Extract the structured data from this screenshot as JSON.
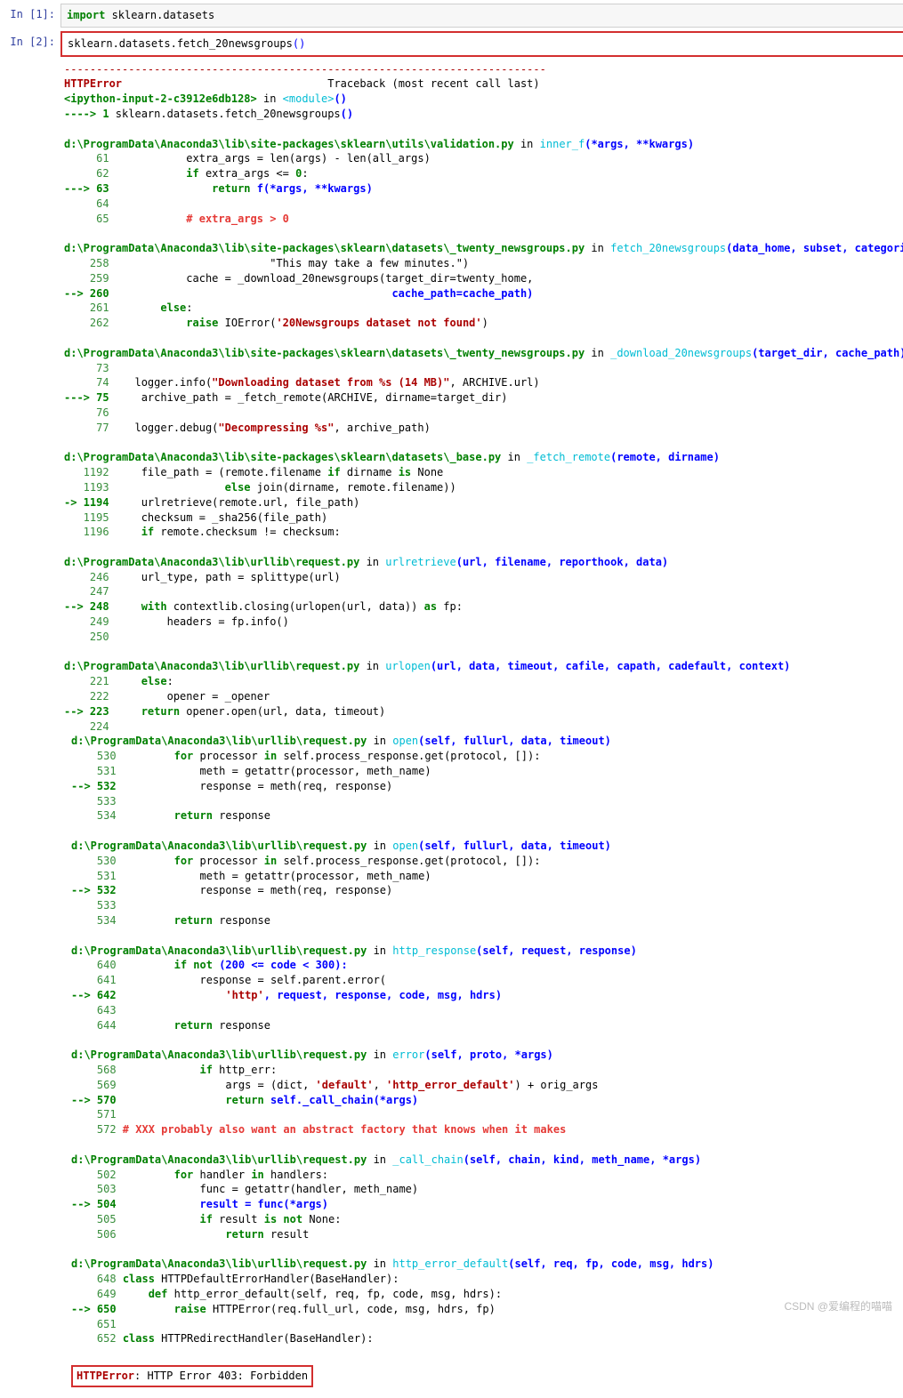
{
  "cells": {
    "in1": {
      "prompt": "In  [1]:",
      "kw": "import",
      "mod": " sklearn.datasets"
    },
    "in2": {
      "prompt": "In  [2]:",
      "code_pre": "sklearn.datasets.fetch_20newsgroups",
      "paren": "()"
    }
  },
  "err": {
    "dashes": "---------------------------------------------------------------------------",
    "name": "HTTPError",
    "trace_hdr": "                                Traceback (most recent call last)",
    "ipy1": "<ipython-input-2-c3912e6db128>",
    "ipy2": " in ",
    "ipy3": "<module>",
    "ipy4": "()",
    "arrow_line": "----> 1 ",
    "arrow_code": "sklearn.datasets.fetch_20newsgroups",
    "arrow_paren": "()",
    "final_name": "HTTPError",
    "final_msg": ": HTTP Error 403: Forbidden"
  },
  "f1": {
    "path": "d:\\ProgramData\\Anaconda3\\lib\\site-packages\\sklearn\\utils\\validation.py",
    "in": " in ",
    "fn": "inner_f",
    "sig": "(*args, **kwargs)",
    "l61n": "     61",
    "l61": "            extra_args = len(args) - len(all_args)",
    "l62n": "     62",
    "l62a": "            ",
    "l62if": "if",
    "l62b": " extra_args <= ",
    "l62z": "0",
    "l62c": ":",
    "l63a": "---> 63",
    "l63b": "                ",
    "l63r": "return",
    "l63c": " f(*args, **kwargs)",
    "l64n": "     64",
    "l65n": "     65",
    "l65": "            # extra_args > 0"
  },
  "f2": {
    "path": "d:\\ProgramData\\Anaconda3\\lib\\site-packages\\sklearn\\datasets\\_twenty_newsgroups.py",
    "in": " in ",
    "fn": "fetch_20newsgroups",
    "sig": "(data_home, subset, categories, shuffle, random_state, remove, download_if_missing, return_X_y)",
    "l258n": "    258",
    "l258": "                         \"This may take a few minutes.\")",
    "l259n": "    259",
    "l259": "            cache = _download_20newsgroups(target_dir=twenty_home,",
    "l260a": "--> 260",
    "l260": "                                            cache_path=cache_path)",
    "l261n": "    261",
    "l261a": "        ",
    "l261e": "else",
    "l261b": ":",
    "l262n": "    262",
    "l262a": "            ",
    "l262r": "raise",
    "l262b": " IOError(",
    "l262s": "'20Newsgroups dataset not found'",
    "l262c": ")"
  },
  "f3": {
    "path": "d:\\ProgramData\\Anaconda3\\lib\\site-packages\\sklearn\\datasets\\_twenty_newsgroups.py",
    "in": " in ",
    "fn": "_download_20newsgroups",
    "sig": "(target_dir, cache_path)",
    "l73n": "     73",
    "l74n": "     74",
    "l74a": "    logger.info(",
    "l74s": "\"Downloading dataset from %s (14 MB)\"",
    "l74b": ", ARCHIVE.url)",
    "l75a": "---> 75",
    "l75": "     archive_path = _fetch_remote(ARCHIVE, dirname=target_dir)",
    "l76n": "     76",
    "l77n": "     77",
    "l77a": "    logger.debug(",
    "l77s": "\"Decompressing %s\"",
    "l77b": ", archive_path)"
  },
  "f4": {
    "path": "d:\\ProgramData\\Anaconda3\\lib\\site-packages\\sklearn\\datasets\\_base.py",
    "in": " in ",
    "fn": "_fetch_remote",
    "sig": "(remote, dirname)",
    "l1192n": "   1192",
    "l1192a": "     file_path = (remote.filename ",
    "l1192if": "if",
    "l1192b": " dirname ",
    "l1192is": "is",
    "l1192c": " None",
    "l1193n": "   1193",
    "l1193a": "                  ",
    "l1193e": "else",
    "l1193b": " join(dirname, remote.filename))",
    "l1194a": "-> 1194",
    "l1194": "     urlretrieve(remote.url, file_path)",
    "l1195n": "   1195",
    "l1195": "     checksum = _sha256(file_path)",
    "l1196n": "   1196",
    "l1196a": "     ",
    "l1196if": "if",
    "l1196b": " remote.checksum != checksum:"
  },
  "f5": {
    "path": "d:\\ProgramData\\Anaconda3\\lib\\urllib\\request.py",
    "in": " in ",
    "fn": "urlretrieve",
    "sig": "(url, filename, reporthook, data)",
    "l246n": "    246",
    "l246": "     url_type, path = splittype(url)",
    "l247n": "    247",
    "l248a": "--> 248",
    "l248b": "     ",
    "l248w": "with",
    "l248c": " contextlib.closing(urlopen(url, data)) ",
    "l248as": "as",
    "l248d": " fp:",
    "l249n": "    249",
    "l249": "         headers = fp.info()",
    "l250n": "    250"
  },
  "f6": {
    "path": "d:\\ProgramData\\Anaconda3\\lib\\urllib\\request.py",
    "in": " in ",
    "fn": "urlopen",
    "sig": "(url, data, timeout, cafile, capath, cadefault, context)",
    "l221n": "    221",
    "l221a": "     ",
    "l221e": "else",
    "l221b": ":",
    "l222n": "    222",
    "l222": "         opener = _opener",
    "l223a": "--> 223",
    "l223b": "     ",
    "l223r": "return",
    "l223c": " opener.open(url, data, timeout)",
    "l224n": "    224"
  },
  "f7": {
    "path": "d:\\ProgramData\\Anaconda3\\lib\\urllib\\request.py",
    "in": " in ",
    "fn": "open",
    "sig": "(self, fullurl, data, timeout)",
    "l530n": "    530",
    "l530a": "         ",
    "l530f": "for",
    "l530b": " processor ",
    "l530i": "in",
    "l530c": " self.process_response.get(protocol, []):",
    "l531n": "    531",
    "l531": "             meth = getattr(processor, meth_name)",
    "l532a": "--> 532",
    "l532": "             response = meth(req, response)",
    "l533n": "    533",
    "l534n": "    534",
    "l534a": "         ",
    "l534r": "return",
    "l534b": " response"
  },
  "f8": {
    "path": "d:\\ProgramData\\Anaconda3\\lib\\urllib\\request.py",
    "in": " in ",
    "fn": "open",
    "sig": "(self, fullurl, data, timeout)",
    "l530n": "    530",
    "l530a": "         ",
    "l530f": "for",
    "l530b": " processor ",
    "l530i": "in",
    "l530c": " self.process_response.get(protocol, []):",
    "l531n": "    531",
    "l531": "             meth = getattr(processor, meth_name)",
    "l532a": "--> 532",
    "l532": "             response = meth(req, response)",
    "l533n": "    533",
    "l534n": "    534",
    "l534a": "         ",
    "l534r": "return",
    "l534b": " response"
  },
  "f9": {
    "path": "d:\\ProgramData\\Anaconda3\\lib\\urllib\\request.py",
    "in": " in ",
    "fn": "http_response",
    "sig": "(self, request, response)",
    "l640n": "    640",
    "l640a": "         ",
    "l640if": "if not",
    "l640b": " (200 <= code < 300):",
    "l641n": "    641",
    "l641": "             response = self.parent.error(",
    "l642a": "--> 642",
    "l642b": "                 ",
    "l642s": "'http'",
    "l642c": ", request, response, code, msg, hdrs)",
    "l643n": "    643",
    "l644n": "    644",
    "l644a": "         ",
    "l644r": "return",
    "l644b": " response"
  },
  "f10": {
    "path": "d:\\ProgramData\\Anaconda3\\lib\\urllib\\request.py",
    "in": " in ",
    "fn": "error",
    "sig": "(self, proto, *args)",
    "l568n": "    568",
    "l568a": "             ",
    "l568if": "if",
    "l568b": " http_err:",
    "l569n": "    569",
    "l569a": "                 args = (dict, ",
    "l569s1": "'default'",
    "l569b": ", ",
    "l569s2": "'http_error_default'",
    "l569c": ") + orig_args",
    "l570a": "--> 570",
    "l570b": "                 ",
    "l570r": "return",
    "l570c": " self._call_chain(*args)",
    "l571n": "    571",
    "l572n": "    572",
    "l572": " # XXX probably also want an abstract factory that knows when it makes"
  },
  "f11": {
    "path": "d:\\ProgramData\\Anaconda3\\lib\\urllib\\request.py",
    "in": " in ",
    "fn": "_call_chain",
    "sig": "(self, chain, kind, meth_name, *args)",
    "l502n": "    502",
    "l502a": "         ",
    "l502f": "for",
    "l502b": " handler ",
    "l502i": "in",
    "l502c": " handlers:",
    "l503n": "    503",
    "l503": "             func = getattr(handler, meth_name)",
    "l504a": "--> 504",
    "l504": "             result = func(*args)",
    "l505n": "    505",
    "l505a": "             ",
    "l505if": "if",
    "l505b": " result ",
    "l505is": "is not",
    "l505c": " None:",
    "l506n": "    506",
    "l506a": "                 ",
    "l506r": "return",
    "l506b": " result"
  },
  "f12": {
    "path": "d:\\ProgramData\\Anaconda3\\lib\\urllib\\request.py",
    "in": " in ",
    "fn": "http_error_default",
    "sig": "(self, req, fp, code, msg, hdrs)",
    "l648n": "    648",
    "l648a": " ",
    "l648c": "class",
    "l648b": " HTTPDefaultErrorHandler(BaseHandler):",
    "l649n": "    649",
    "l649a": "     ",
    "l649d": "def",
    "l649b": " http_error_default(self, req, fp, code, msg, hdrs):",
    "l650a": "--> 650",
    "l650b": "         ",
    "l650r": "raise",
    "l650c": " HTTPError(req.full_url, code, msg, hdrs, fp)",
    "l651n": "    651",
    "l652n": "    652",
    "l652a": " ",
    "l652c": "class",
    "l652b": " HTTPRedirectHandler(BaseHandler):"
  },
  "watermark": "CSDN @爱编程的喵喵"
}
